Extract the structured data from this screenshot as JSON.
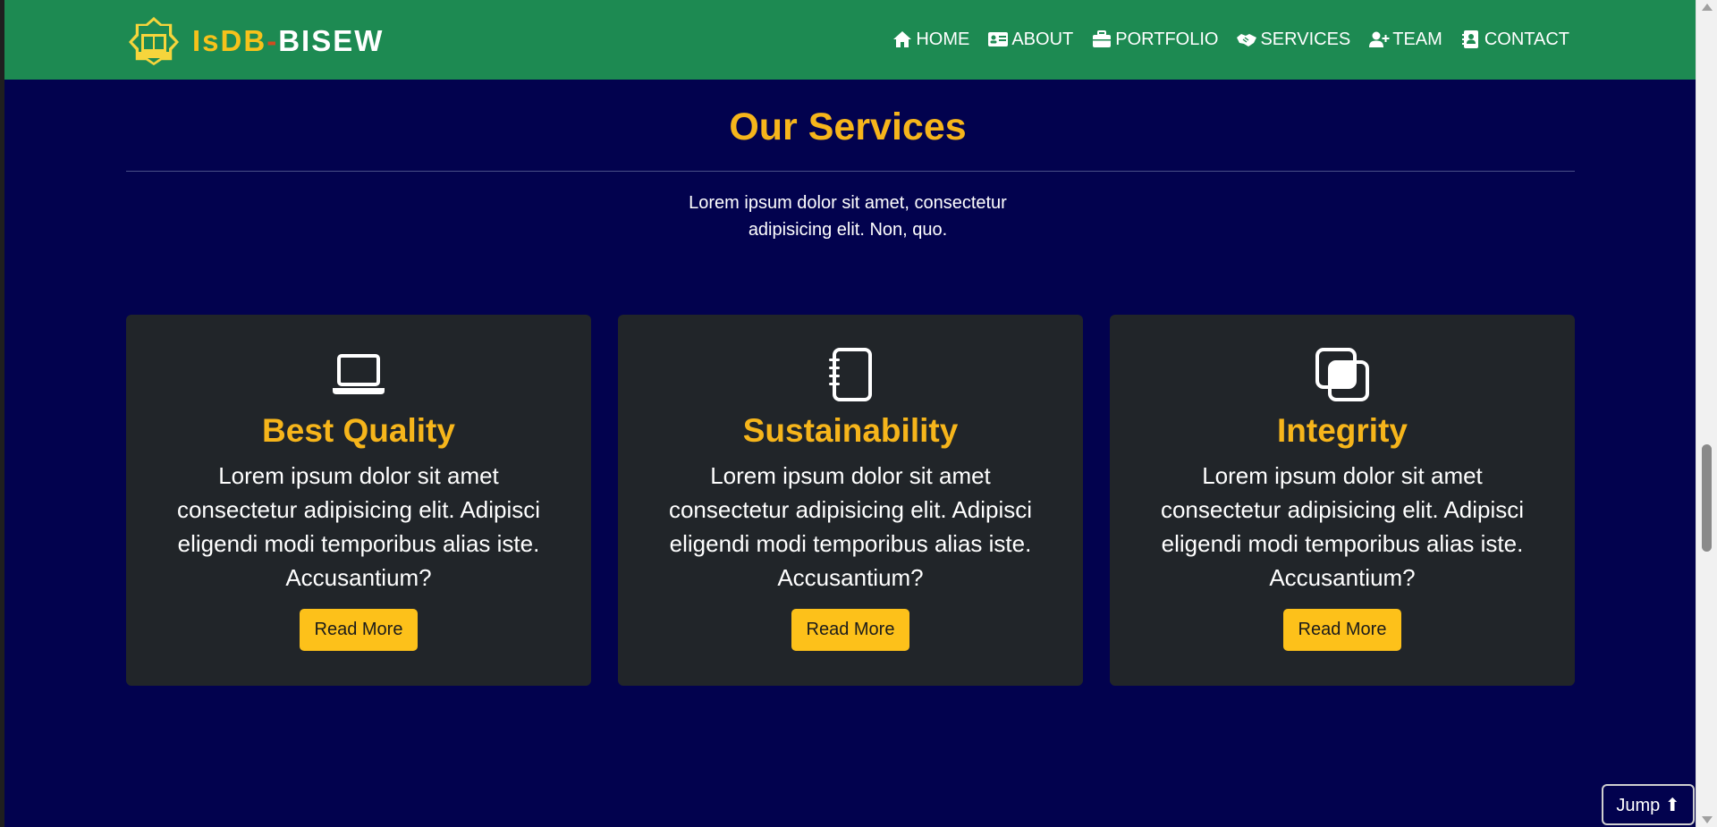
{
  "brand": {
    "name_a": "IsDB",
    "dash": "-",
    "name_b": "BISEW",
    "logo_text": "IsDB-BISEW"
  },
  "nav": [
    {
      "label": "HOME",
      "icon": "home-icon"
    },
    {
      "label": "ABOUT",
      "icon": "id-card-icon"
    },
    {
      "label": "PORTFOLIO",
      "icon": "briefcase-icon"
    },
    {
      "label": "SERVICES",
      "icon": "handshake-icon"
    },
    {
      "label": "TEAM",
      "icon": "user-plus-icon"
    },
    {
      "label": "CONTACT",
      "icon": "address-book-icon"
    }
  ],
  "services": {
    "title": "Our Services",
    "subtitle": "Lorem ipsum dolor sit amet, consectetur adipisicing elit. Non, quo.",
    "cards": [
      {
        "icon": "laptop-icon",
        "title": "Best Quality",
        "text": "Lorem ipsum dolor sit amet consectetur adipisicing elit. Adipisci eligendi modi temporibus alias iste. Accusantium?",
        "button": "Read More"
      },
      {
        "icon": "journal-icon",
        "title": "Sustainability",
        "text": "Lorem ipsum dolor sit amet consectetur adipisicing elit. Adipisci eligendi modi temporibus alias iste. Accusantium?",
        "button": "Read More"
      },
      {
        "icon": "overlapping-squares-icon",
        "title": "Integrity",
        "text": "Lorem ipsum dolor sit amet consectetur adipisicing elit. Adipisci eligendi modi temporibus alias iste. Accusantium?",
        "button": "Read More"
      }
    ]
  },
  "jump": {
    "label": "Jump ⬆"
  },
  "colors": {
    "navbar": "#1d8a52",
    "background": "#02024e",
    "accent": "#f6b51b",
    "card": "#212529",
    "button": "#fdc11a"
  }
}
